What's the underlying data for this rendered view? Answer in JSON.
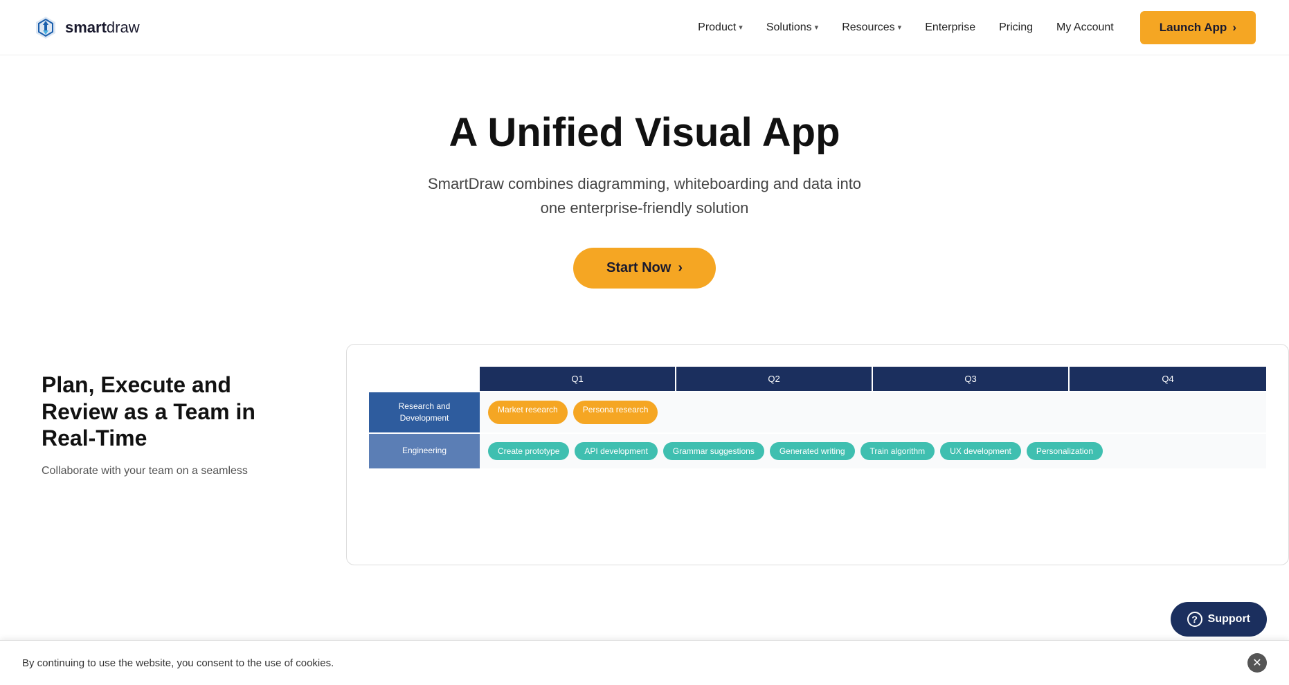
{
  "brand": {
    "name_bold": "smart",
    "name_light": "draw"
  },
  "nav": {
    "items": [
      {
        "label": "Product",
        "has_dropdown": true
      },
      {
        "label": "Solutions",
        "has_dropdown": true
      },
      {
        "label": "Resources",
        "has_dropdown": true
      },
      {
        "label": "Enterprise",
        "has_dropdown": false
      },
      {
        "label": "Pricing",
        "has_dropdown": false
      },
      {
        "label": "My Account",
        "has_dropdown": false
      }
    ],
    "launch_btn": "Launch App",
    "launch_arrow": "›"
  },
  "hero": {
    "title": "A Unified Visual App",
    "subtitle": "SmartDraw combines diagramming, whiteboarding and data into one enterprise-friendly solution",
    "cta_label": "Start Now",
    "cta_arrow": "›"
  },
  "lower": {
    "title": "Plan, Execute and Review as a Team in Real-Time",
    "description": "Collaborate with your team on a seamless"
  },
  "gantt": {
    "columns": [
      "Q1",
      "Q2",
      "Q3",
      "Q4"
    ],
    "rows": [
      {
        "label": "Research and Development",
        "tags": [
          {
            "text": "Market research",
            "style": "yellow"
          },
          {
            "text": "Persona research",
            "style": "yellow"
          }
        ]
      },
      {
        "label": "Engineering",
        "tags": [
          {
            "text": "Create prototype",
            "style": "teal"
          },
          {
            "text": "API development",
            "style": "teal"
          },
          {
            "text": "Grammar suggestions",
            "style": "teal"
          },
          {
            "text": "Generated writing",
            "style": "teal"
          },
          {
            "text": "Train algorithm",
            "style": "teal"
          },
          {
            "text": "UX development",
            "style": "teal"
          },
          {
            "text": "Personalization",
            "style": "teal"
          }
        ]
      }
    ]
  },
  "cookie": {
    "text": "By continuing to use the website, you consent to the use of cookies."
  },
  "support": {
    "label": "Support",
    "icon": "?"
  }
}
